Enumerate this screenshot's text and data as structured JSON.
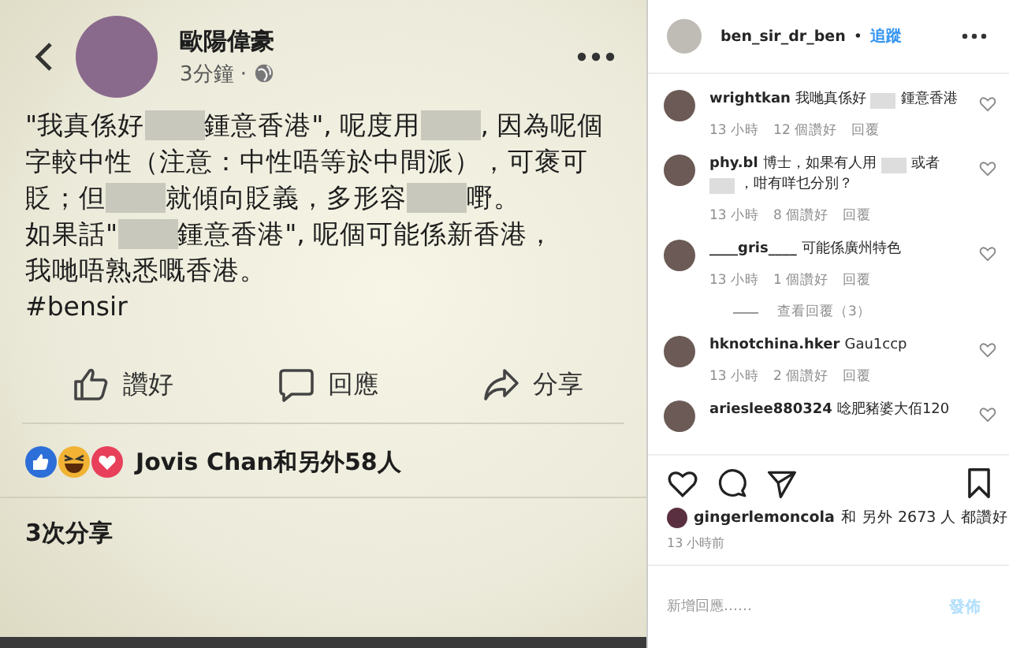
{
  "post": {
    "author": "歐陽偉豪",
    "time": "3分鐘 ·",
    "lines": [
      [
        {
          "kind": "text",
          "text": "\"我真係好"
        },
        {
          "kind": "redacted"
        },
        {
          "kind": "text",
          "text": "鍾意香港\", 呢度用"
        },
        {
          "kind": "redacted"
        },
        {
          "kind": "text",
          "text": ", 因為呢個"
        }
      ],
      [
        {
          "kind": "text",
          "text": "字較中性（注意：中性唔等於中間派），可褒可"
        }
      ],
      [
        {
          "kind": "text",
          "text": "貶；但"
        },
        {
          "kind": "redacted"
        },
        {
          "kind": "text",
          "text": "就傾向貶義，多形容"
        },
        {
          "kind": "redacted"
        },
        {
          "kind": "text",
          "text": "嘢。"
        }
      ],
      [
        {
          "kind": "text",
          "text": "如果話\""
        },
        {
          "kind": "redacted"
        },
        {
          "kind": "text",
          "text": "鍾意香港\", 呢個可能係新香港，"
        }
      ],
      [
        {
          "kind": "text",
          "text": "我哋唔熟悉嘅香港。"
        }
      ],
      [
        {
          "kind": "text",
          "text": "#bensir"
        }
      ]
    ],
    "actions": [
      {
        "kind": "like",
        "label": "讚好"
      },
      {
        "kind": "comment",
        "label": "回應"
      },
      {
        "kind": "share",
        "label": "分享"
      }
    ],
    "reactions_text": "Jovis Chan和另外58人",
    "shares": "3次分享"
  },
  "profile": {
    "username": "ben_sir_dr_ben",
    "separator": "•",
    "follow": "追蹤"
  },
  "comments": [
    {
      "user": "wrightkan",
      "parts": [
        {
          "kind": "text",
          "text": "我哋真係好"
        },
        {
          "kind": "redacted"
        },
        {
          "kind": "text",
          "text": "鍾意香港"
        }
      ],
      "time": "13 小時",
      "likes": "12 個讚好",
      "reply": "回覆"
    },
    {
      "user": "phy.bl",
      "parts": [
        {
          "kind": "text",
          "text": "博士，如果有人用"
        },
        {
          "kind": "redacted"
        },
        {
          "kind": "text",
          "text": "或者"
        },
        {
          "kind": "redacted"
        },
        {
          "kind": "text",
          "text": "，咁有咩乜分別？"
        }
      ],
      "time": "13 小時",
      "likes": "8 個讚好",
      "reply": "回覆"
    },
    {
      "user": "____gris____",
      "parts": [
        {
          "kind": "text",
          "text": "可能係廣州特色"
        }
      ],
      "time": "13 小時",
      "likes": "1 個讚好",
      "reply": "回覆",
      "replies_link": "查看回覆（3）"
    },
    {
      "user": "hknotchina.hker",
      "parts": [
        {
          "kind": "text",
          "text": "Gau1ccp"
        }
      ],
      "time": "13 小時",
      "likes": "2 個讚好",
      "reply": "回覆"
    },
    {
      "user": "arieslee880324",
      "parts": [
        {
          "kind": "text",
          "text": "唸肥豬婆大佰120"
        }
      ]
    }
  ],
  "liked_by": "gingerlemoncola",
  "likes_text": "和 另外 2673 人 都讚好",
  "posted": "13 小時前",
  "comment_placeholder": "新增回應……",
  "post_button": "發佈"
}
